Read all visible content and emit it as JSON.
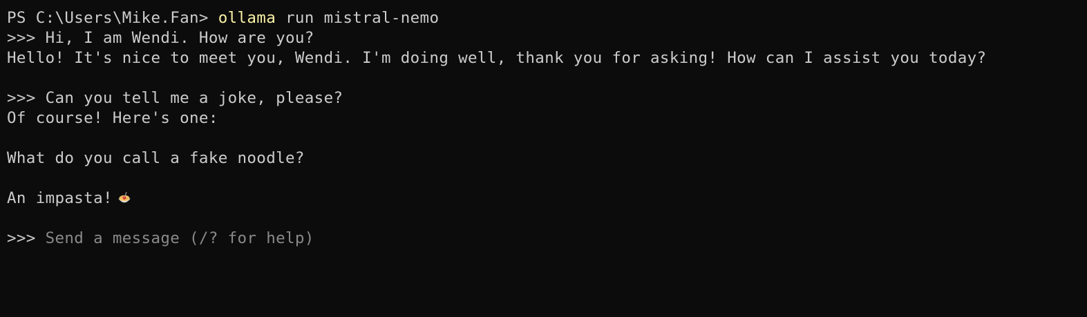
{
  "session": {
    "ps_prompt": "PS C:\\Users\\Mike.Fan> ",
    "command": "ollama",
    "command_args": " run mistral-nemo",
    "chat_prompt": ">>> "
  },
  "conversation": {
    "user_1": "Hi, I am Wendi. How are you?",
    "reply_1": "Hello! It's nice to meet you, Wendi. I'm doing well, thank you for asking! How can I assist you today?",
    "user_2": "Can you tell me a joke, please?",
    "reply_2_line_1": "Of course! Here's one:",
    "reply_2_line_2": "What do you call a fake noodle?",
    "reply_2_line_3": "An impasta!"
  },
  "input": {
    "placeholder": "Send a message (/? for help)",
    "value": ""
  },
  "colors": {
    "background": "#0c0c0c",
    "text": "#cccccc",
    "command_highlight": "#f9f1a5",
    "placeholder": "#8a8a8a"
  },
  "icons": {
    "emoji": "spaghetti-icon"
  }
}
